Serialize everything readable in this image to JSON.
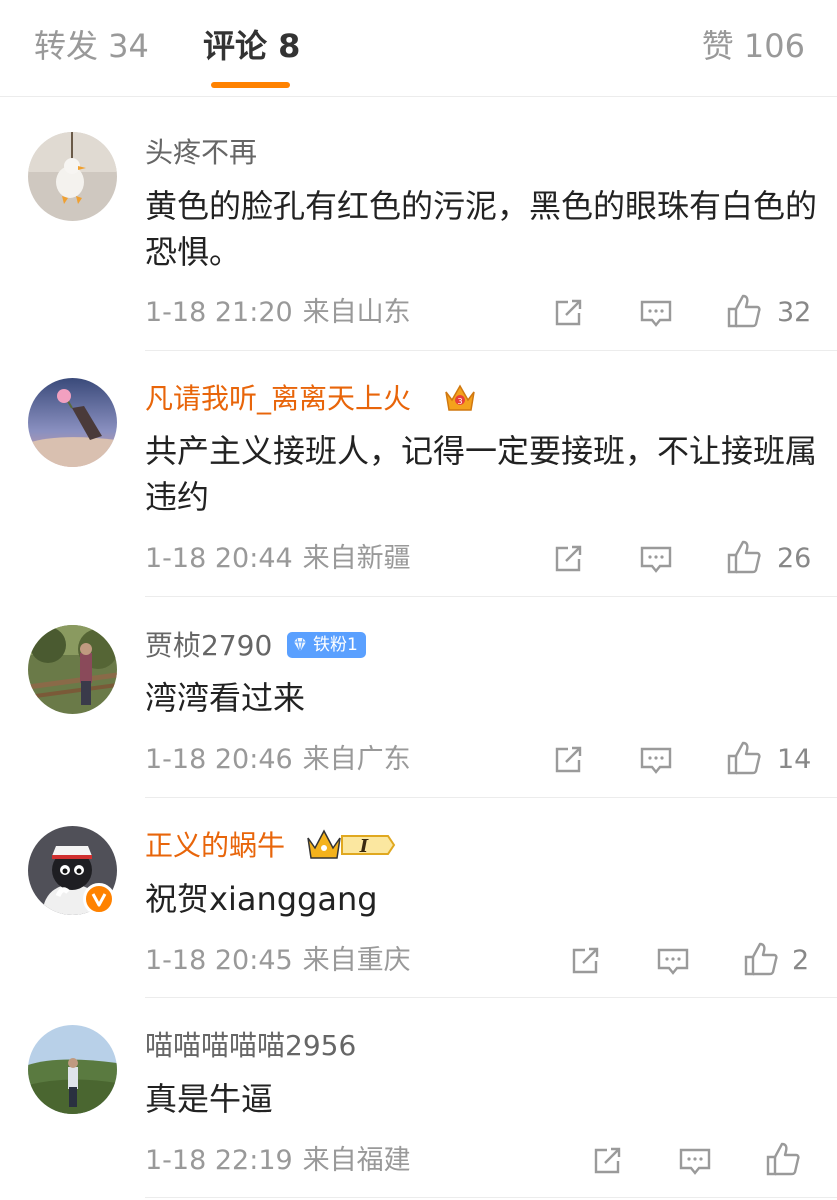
{
  "tabs": {
    "repost": "转发 34",
    "comment": "评论 8",
    "like": "赞 106"
  },
  "colors": {
    "accent": "#ff8200",
    "vip_name": "#e8650a",
    "text_primary": "#222222",
    "text_muted": "#999999",
    "badge_blue": "#5aa0ff"
  },
  "comments": [
    {
      "username": "头疼不再",
      "content": "黄色的脸孔有红色的污泥，黑色的眼珠有白色的恐惧。",
      "time": "1-18 21:20",
      "location": "来自山东",
      "likes": "32",
      "avatar_icon": "duck-figurine-avatar"
    },
    {
      "username": "凡请我听_离离天上火",
      "badge_icon": "crown-vip-icon",
      "content": "共产主义接班人，记得一定要接班，不让接班属违约",
      "time": "1-18 20:44",
      "location": "来自新疆",
      "likes": "26",
      "avatar_icon": "hand-holding-flower-avatar"
    },
    {
      "username": "贾桢2790",
      "badge_label": "铁粉1",
      "content": "湾湾看过来",
      "time": "1-18 20:46",
      "location": "来自广东",
      "likes": "14",
      "avatar_icon": "person-on-bridge-avatar"
    },
    {
      "username": "正义的蜗牛",
      "badge_icon": "crown-level-i-icon",
      "verified_icon": "verified-v-icon",
      "content": "祝贺xianggang",
      "time": "1-18 20:45",
      "location": "来自重庆",
      "likes": "2",
      "avatar_icon": "cartoon-cat-police-avatar"
    },
    {
      "username": "喵喵喵喵喵2956",
      "content": "真是牛逼",
      "time": "1-18 22:19",
      "location": "来自福建",
      "likes": "",
      "avatar_icon": "person-landscape-avatar"
    }
  ]
}
